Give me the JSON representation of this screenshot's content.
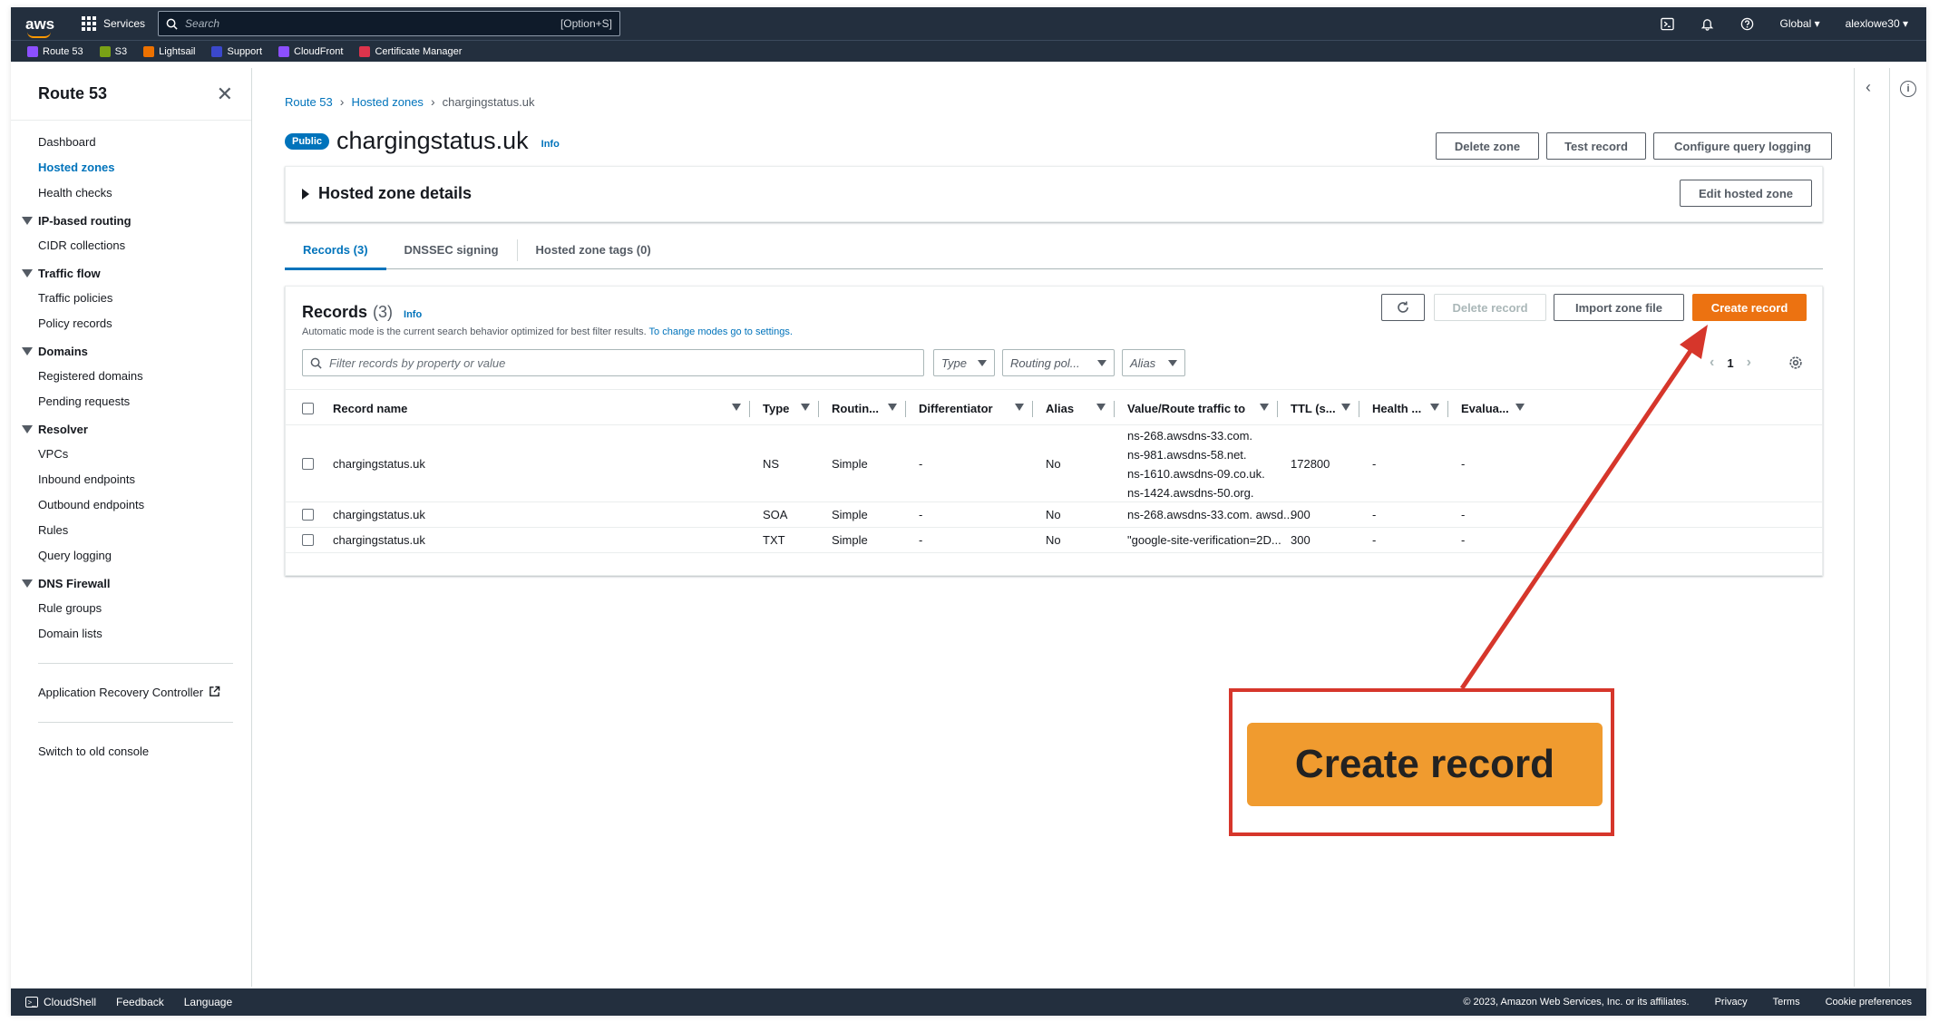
{
  "topnav": {
    "logo": "aws",
    "services_label": "Services",
    "search_placeholder": "Search",
    "search_shortcut": "[Option+S]",
    "region_label": "Global",
    "user_label": "alexlowe30",
    "icons": [
      "cloudshell-icon",
      "bell-icon",
      "help-icon"
    ]
  },
  "favorites": [
    {
      "label": "Route 53",
      "color": "#8c4fff"
    },
    {
      "label": "S3",
      "color": "#7aa116"
    },
    {
      "label": "Lightsail",
      "color": "#ed7100"
    },
    {
      "label": "Support",
      "color": "#3b48cc"
    },
    {
      "label": "CloudFront",
      "color": "#8c4fff"
    },
    {
      "label": "Certificate Manager",
      "color": "#dd344c"
    }
  ],
  "sidebar": {
    "title": "Route 53",
    "top_items": [
      "Dashboard",
      "Hosted zones",
      "Health checks"
    ],
    "active_item": "Hosted zones",
    "sections": [
      {
        "title": "IP-based routing",
        "items": [
          "CIDR collections"
        ]
      },
      {
        "title": "Traffic flow",
        "items": [
          "Traffic policies",
          "Policy records"
        ]
      },
      {
        "title": "Domains",
        "items": [
          "Registered domains",
          "Pending requests"
        ]
      },
      {
        "title": "Resolver",
        "items": [
          "VPCs",
          "Inbound endpoints",
          "Outbound endpoints",
          "Rules",
          "Query logging"
        ]
      },
      {
        "title": "DNS Firewall",
        "items": [
          "Rule groups",
          "Domain lists"
        ]
      }
    ],
    "arc_label": "Application Recovery Controller",
    "old_console_label": "Switch to old console"
  },
  "breadcrumb": [
    "Route 53",
    "Hosted zones",
    "chargingstatus.uk"
  ],
  "header": {
    "badge": "Public",
    "title": "chargingstatus.uk",
    "info": "Info",
    "buttons": {
      "delete_zone": "Delete zone",
      "test_record": "Test record",
      "query_logging": "Configure query logging"
    }
  },
  "hosted_zone_details": {
    "title": "Hosted zone details",
    "edit_button": "Edit hosted zone"
  },
  "tabs": [
    {
      "label": "Records (3)",
      "active": true
    },
    {
      "label": "DNSSEC signing",
      "active": false
    },
    {
      "label": "Hosted zone tags (0)",
      "active": false
    }
  ],
  "records": {
    "title": "Records",
    "count": "(3)",
    "info": "Info",
    "description": "Automatic mode is the current search behavior optimized for best filter results.",
    "description_link": "To change modes go to settings.",
    "buttons": {
      "delete": "Delete record",
      "import": "Import zone file",
      "create": "Create record"
    },
    "filter_placeholder": "Filter records by property or value",
    "filters": {
      "type": "Type",
      "routing": "Routing pol...",
      "alias": "Alias"
    },
    "page": "1",
    "columns": [
      "Record name",
      "Type",
      "Routin...",
      "Differentiator",
      "Alias",
      "Value/Route traffic to",
      "TTL (s...",
      "Health ...",
      "Evalua..."
    ],
    "rows": [
      {
        "name": "chargingstatus.uk",
        "type": "NS",
        "routing": "Simple",
        "diff": "-",
        "alias": "No",
        "values": [
          "ns-268.awsdns-33.com.",
          "ns-981.awsdns-58.net.",
          "ns-1610.awsdns-09.co.uk.",
          "ns-1424.awsdns-50.org."
        ],
        "ttl": "172800",
        "health": "-",
        "eval": "-"
      },
      {
        "name": "chargingstatus.uk",
        "type": "SOA",
        "routing": "Simple",
        "diff": "-",
        "alias": "No",
        "values": [
          "ns-268.awsdns-33.com. awsd..."
        ],
        "ttl": "900",
        "health": "-",
        "eval": "-"
      },
      {
        "name": "chargingstatus.uk",
        "type": "TXT",
        "routing": "Simple",
        "diff": "-",
        "alias": "No",
        "values": [
          "\"google-site-verification=2D..."
        ],
        "ttl": "300",
        "health": "-",
        "eval": "-"
      }
    ]
  },
  "annotation": {
    "zoom_label": "Create record",
    "color": "#d6362b"
  },
  "footer": {
    "cloudshell": "CloudShell",
    "feedback": "Feedback",
    "language": "Language",
    "copyright": "© 2023, Amazon Web Services, Inc. or its affiliates.",
    "privacy": "Privacy",
    "terms": "Terms",
    "cookies": "Cookie preferences"
  }
}
